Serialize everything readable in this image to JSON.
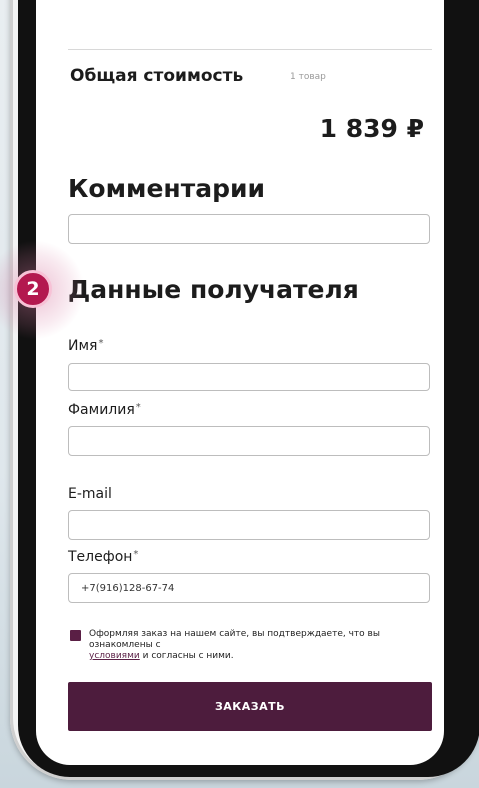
{
  "summary": {
    "total_label": "Общая стоимость",
    "item_count": "1 товар",
    "total_price": "1 839 ₽"
  },
  "comments": {
    "heading": "Комментарии",
    "value": ""
  },
  "step": {
    "number": "2",
    "color": "#b3194f"
  },
  "recipient": {
    "heading": "Данные получателя",
    "first_name_label": "Имя",
    "first_name_value": "",
    "last_name_label": "Фамилия",
    "last_name_value": "",
    "email_label": "E-mail",
    "email_value": "",
    "phone_label": "Телефон",
    "phone_value": "+7(916)128-67-74",
    "required_mark": "*"
  },
  "agreement": {
    "checked": true,
    "text_before": "Оформляя заказ на нашем сайте, вы подтверждаете, что вы ознакомлены с",
    "link_text": "условиями",
    "text_after": "и согласны с ними."
  },
  "order_button": {
    "label": "ЗАКАЗАТЬ",
    "color": "#4d1c3d"
  }
}
